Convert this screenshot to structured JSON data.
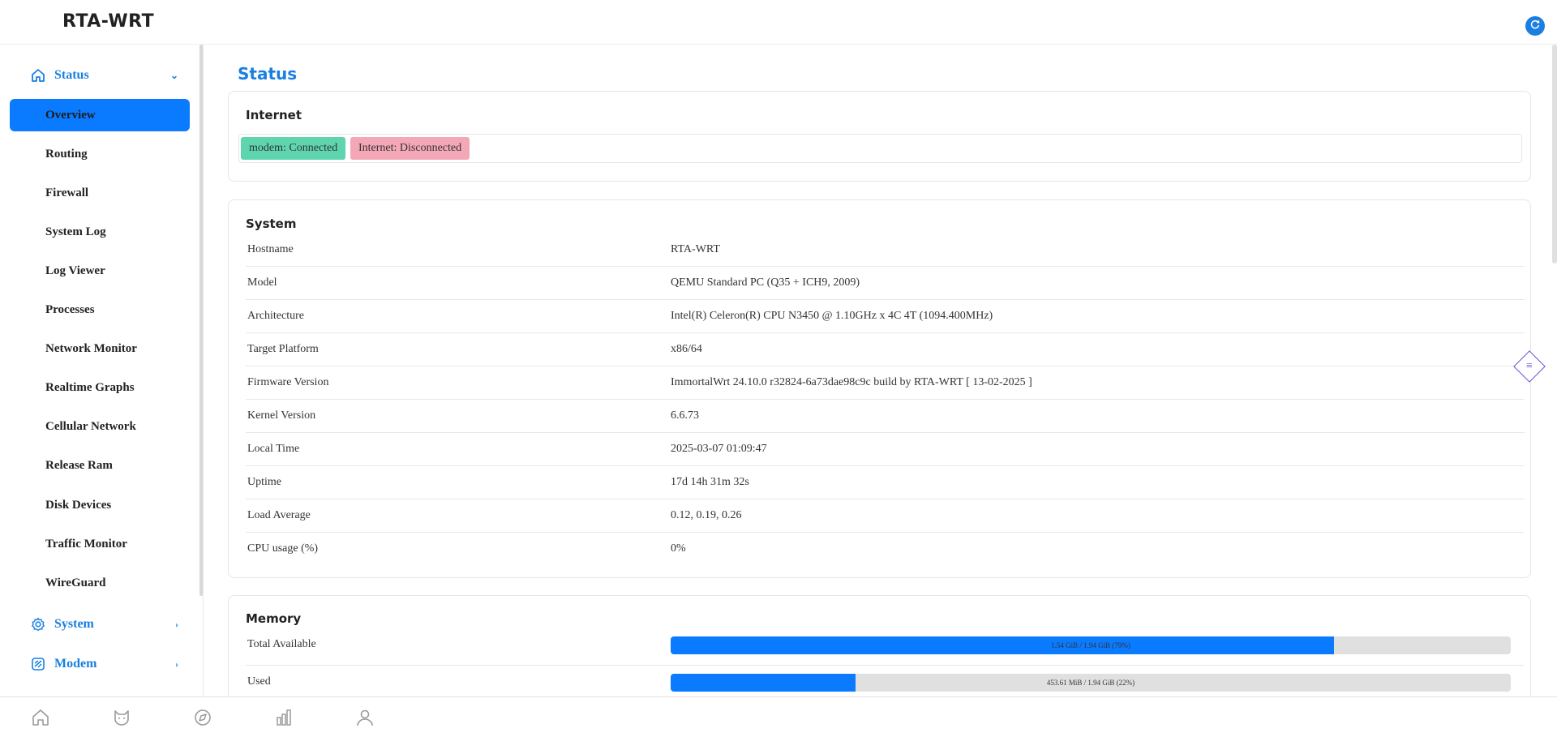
{
  "header": {
    "brand": "RTA-WRT"
  },
  "sidebar": {
    "status_group": {
      "label": "Status"
    },
    "items": [
      {
        "label": "Overview",
        "active": true
      },
      {
        "label": "Routing"
      },
      {
        "label": "Firewall"
      },
      {
        "label": "System Log"
      },
      {
        "label": "Log Viewer"
      },
      {
        "label": "Processes"
      },
      {
        "label": "Network Monitor"
      },
      {
        "label": "Realtime Graphs"
      },
      {
        "label": "Cellular Network"
      },
      {
        "label": "Release Ram"
      },
      {
        "label": "Disk Devices"
      },
      {
        "label": "Traffic Monitor"
      },
      {
        "label": "WireGuard"
      }
    ],
    "system_group": {
      "label": "System"
    },
    "modem_group": {
      "label": "Modem"
    }
  },
  "main": {
    "title": "Status",
    "internet": {
      "title": "Internet",
      "badges": [
        {
          "text": "modem: Connected",
          "status": "ok"
        },
        {
          "text": "Internet: Disconnected",
          "status": "bad"
        }
      ]
    },
    "system": {
      "title": "System",
      "rows": [
        {
          "key": "Hostname",
          "value": "RTA-WRT"
        },
        {
          "key": "Model",
          "value": "QEMU Standard PC (Q35 + ICH9, 2009)"
        },
        {
          "key": "Architecture",
          "value": "Intel(R) Celeron(R) CPU N3450 @ 1.10GHz x 4C 4T (1094.400MHz)"
        },
        {
          "key": "Target Platform",
          "value": "x86/64"
        },
        {
          "key": "Firmware Version",
          "value": "ImmortalWrt 24.10.0 r32824-6a73dae98c9c build by RTA-WRT [ 13-02-2025 ]"
        },
        {
          "key": "Kernel Version",
          "value": "6.6.73"
        },
        {
          "key": "Local Time",
          "value": "2025-03-07 01:09:47"
        },
        {
          "key": "Uptime",
          "value": "17d 14h 31m 32s"
        },
        {
          "key": "Load Average",
          "value": "0.12, 0.19, 0.26"
        },
        {
          "key": "CPU usage (%)",
          "value": "0%"
        }
      ]
    },
    "memory": {
      "title": "Memory",
      "rows": [
        {
          "key": "Total Available",
          "label": "1.54 GiB / 1.94 GiB (79%)",
          "fraction": 0.79
        },
        {
          "key": "Used",
          "label": "453.61 MiB / 1.94 GiB (22%)",
          "fraction": 0.22
        }
      ]
    }
  },
  "colors": {
    "accent": "#1a7fe0",
    "active": "#0a7bff",
    "ok": "#5ed5ae",
    "bad": "#f4a7b7"
  },
  "bottom_bar": {
    "icons": [
      "home-icon",
      "cat-icon",
      "compass-icon",
      "bar-chart-icon",
      "user-icon"
    ]
  }
}
